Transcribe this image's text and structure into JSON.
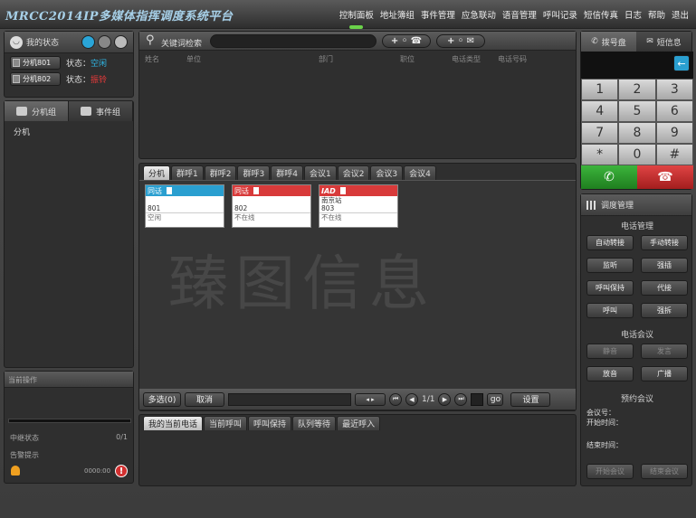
{
  "header": {
    "title": "MRCC2014IP多媒体指挥调度系统平台",
    "nav": [
      "控制面板",
      "地址簿组",
      "事件管理",
      "应急联动",
      "语音管理",
      "呼叫记录",
      "短信传真",
      "日志",
      "帮助",
      "退出"
    ]
  },
  "status": {
    "title": "我的状态",
    "extensions": [
      {
        "label": "分机801",
        "state_label": "状态：",
        "state": "空闲",
        "state_color": "#2fb8e8"
      },
      {
        "label": "分机802",
        "state_label": "状态：",
        "state": "振铃",
        "state_color": "#e83a3a"
      }
    ]
  },
  "groups": {
    "tabs": [
      "分机组",
      "事件组"
    ],
    "items": [
      "分机"
    ]
  },
  "ops": {
    "title": "当前操作",
    "busy_label": "中继状态",
    "busy_value": "0/1",
    "alarm_label": "告警提示",
    "alarm_value": "0000:00"
  },
  "search": {
    "label": "关键词检索",
    "placeholder": "",
    "columns": [
      "姓名",
      "单位",
      "部门",
      "职位",
      "电话类型",
      "电话号码"
    ]
  },
  "tabs": {
    "items": [
      "分机",
      "群呼1",
      "群呼2",
      "群呼3",
      "群呼4",
      "会议1",
      "会议2",
      "会议3",
      "会议4"
    ],
    "cards": [
      {
        "type": "同话",
        "color": "#2a9fd0",
        "name": "",
        "number": "801",
        "status": "空闲"
      },
      {
        "type": "同话",
        "color": "#d83a3a",
        "name": "",
        "number": "802",
        "status": "不在线"
      },
      {
        "type": "IAD",
        "color": "#d83a3a",
        "name": "南京站",
        "number": "803",
        "status": "不在线"
      }
    ],
    "watermark": "臻图信息",
    "footer": {
      "select_all": "多选(0)",
      "cancel": "取消",
      "page": "1/1",
      "go": "go",
      "settings": "设置"
    }
  },
  "calls": {
    "tabs": [
      "我的当前电话",
      "当前呼叫",
      "呼叫保持",
      "队列等待",
      "最近呼入"
    ]
  },
  "dial": {
    "tabs": [
      "拨号盘",
      "短信息"
    ],
    "keys": [
      "1",
      "2",
      "3",
      "4",
      "5",
      "6",
      "7",
      "8",
      "9",
      "*",
      "0",
      "#"
    ]
  },
  "dispatch": {
    "title": "调度管理",
    "phone_section": "电话管理",
    "phone_buttons": [
      "自动转接",
      "手动转接",
      "监听",
      "强插",
      "呼叫保持",
      "代接",
      "呼叫",
      "强拆"
    ],
    "conf_section": "电话会议",
    "conf_buttons": [
      "静音",
      "发言",
      "放音",
      "广播"
    ],
    "plan_section": "预约会议",
    "conf_no": "会议号：",
    "start_time": "开始时间：",
    "end_time": "结束时间：",
    "start_conf": "开始会议",
    "end_conf": "结束会议"
  }
}
